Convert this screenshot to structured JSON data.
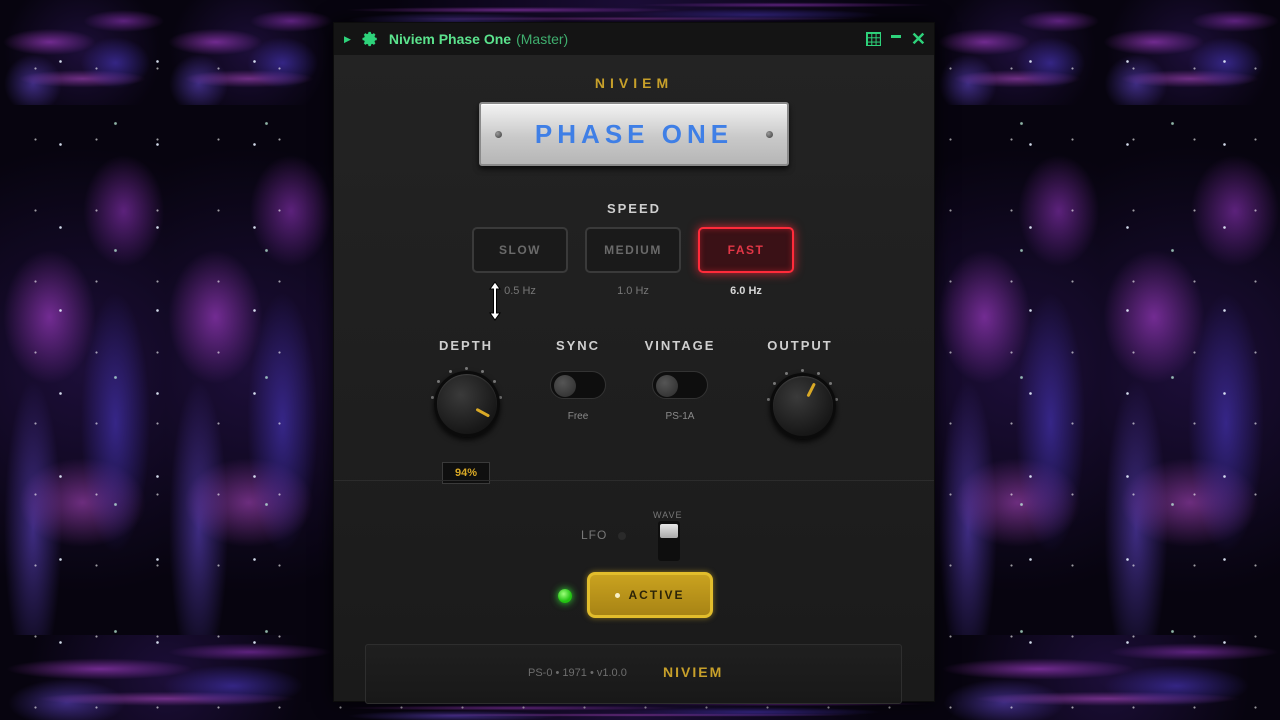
{
  "window": {
    "title": "Niviem Phase One",
    "subtitle": "(Master)"
  },
  "plugin": {
    "brand": "NIVIEM",
    "name": "PHASE ONE"
  },
  "speed": {
    "label": "SPEED",
    "options": [
      {
        "label": "SLOW",
        "rate": "0.5 Hz",
        "selected": false
      },
      {
        "label": "MEDIUM",
        "rate": "1.0 Hz",
        "selected": false
      },
      {
        "label": "FAST",
        "rate": "6.0 Hz",
        "selected": true
      }
    ]
  },
  "depth": {
    "label": "DEPTH",
    "value": "94%",
    "level": 0.94
  },
  "sync": {
    "label": "SYNC",
    "state_label": "Free",
    "on": false
  },
  "vintage": {
    "label": "VINTAGE",
    "state_label": "PS-1A",
    "on": false
  },
  "output": {
    "label": "OUTPUT",
    "level": 0.6
  },
  "lfo": {
    "label": "LFO",
    "on": false
  },
  "wave": {
    "label": "WAVE"
  },
  "active": {
    "label": "ACTIVE",
    "on": true
  },
  "footer": {
    "info": "PS-0 • 1971 • v1.0.0",
    "brand": "NIVIEM"
  },
  "colors": {
    "accent_gold": "#c7a02a",
    "titlebar_green": "#2ed37b",
    "fast_red": "#ff2b3a",
    "plate_blue": "#3f7fe6"
  }
}
